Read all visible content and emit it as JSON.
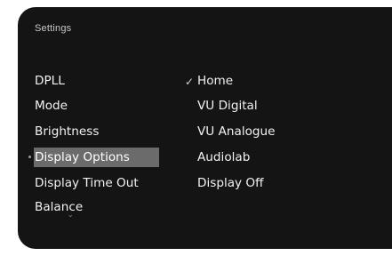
{
  "settings": {
    "title": "Settings",
    "menu": [
      {
        "label": "DPLL"
      },
      {
        "label": "Mode"
      },
      {
        "label": "Brightness"
      },
      {
        "label": "Display Options",
        "selected": true
      },
      {
        "label": "Display Time Out"
      },
      {
        "label": "Balance"
      }
    ],
    "options": [
      {
        "label": "Home",
        "checked": true
      },
      {
        "label": "VU Digital"
      },
      {
        "label": "VU Analogue"
      },
      {
        "label": "Audiolab"
      },
      {
        "label": "Display Off"
      }
    ],
    "check_glyph": "✓",
    "scroll_glyph": "⌄"
  },
  "icons": {
    "check": "checkmark-icon",
    "scroll_down": "chevron-down-icon"
  },
  "colors": {
    "background": "#141414",
    "selection": "#6b6b6b",
    "text": "#f2f2f2"
  }
}
